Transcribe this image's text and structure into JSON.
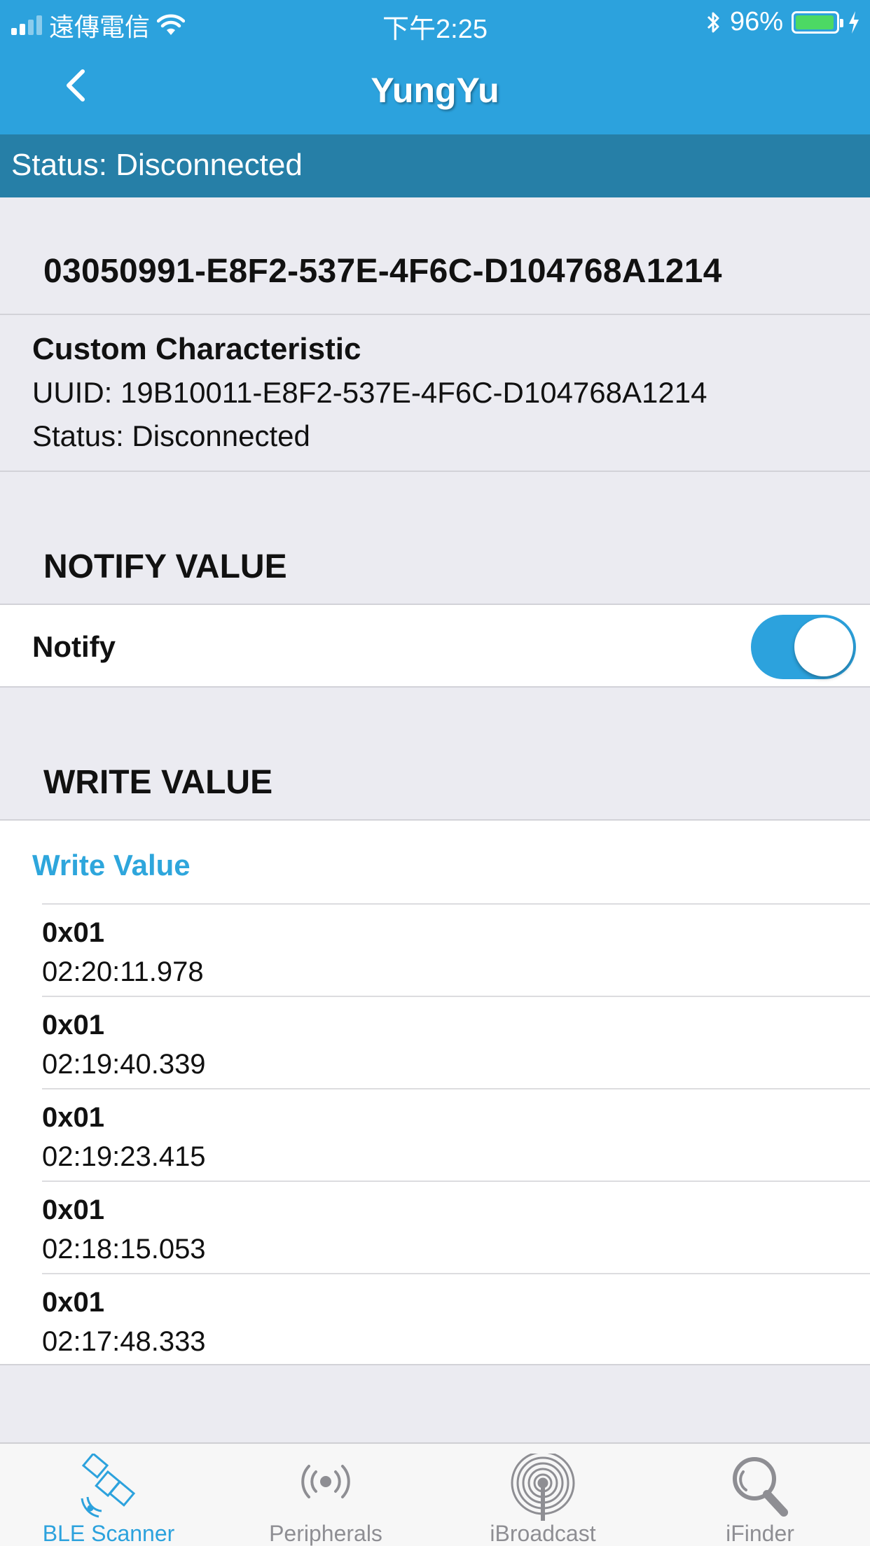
{
  "status_bar": {
    "carrier": "遠傳電信",
    "time": "下午2:25",
    "battery_percent": "96%",
    "battery_level": 0.96,
    "icons": [
      "signal-icon",
      "wifi-icon",
      "bluetooth-icon",
      "battery-icon",
      "charging-icon"
    ]
  },
  "nav": {
    "title": "YungYu",
    "back_icon": "chevron-left-icon"
  },
  "connection_banner": "Status: Disconnected",
  "service_uuid": "03050991-E8F2-537E-4F6C-D104768A1214",
  "characteristic": {
    "title": "Custom Characteristic",
    "uuid": "UUID: 19B10011-E8F2-537E-4F6C-D104768A1214",
    "status": "Status: Disconnected"
  },
  "notify_section": {
    "header": "NOTIFY VALUE",
    "label": "Notify",
    "enabled": true
  },
  "write_section": {
    "header": "WRITE VALUE",
    "action_label": "Write Value",
    "log": [
      {
        "value": "0x01",
        "time": "02:20:11.978"
      },
      {
        "value": "0x01",
        "time": "02:19:40.339"
      },
      {
        "value": "0x01",
        "time": "02:19:23.415"
      },
      {
        "value": "0x01",
        "time": "02:18:15.053"
      },
      {
        "value": "0x01",
        "time": "02:17:48.333"
      }
    ]
  },
  "tabs": [
    {
      "label": "BLE Scanner",
      "icon": "satellite-icon",
      "active": true
    },
    {
      "label": "Peripherals",
      "icon": "broadcast-waves-icon",
      "active": false
    },
    {
      "label": "iBroadcast",
      "icon": "concentric-circles-icon",
      "active": false
    },
    {
      "label": "iFinder",
      "icon": "magnifier-icon",
      "active": false
    }
  ],
  "colors": {
    "nav_blue": "#2ca2dd",
    "banner_blue": "#267fa7",
    "accent": "#2ea6dc",
    "background": "#ebebf1"
  }
}
